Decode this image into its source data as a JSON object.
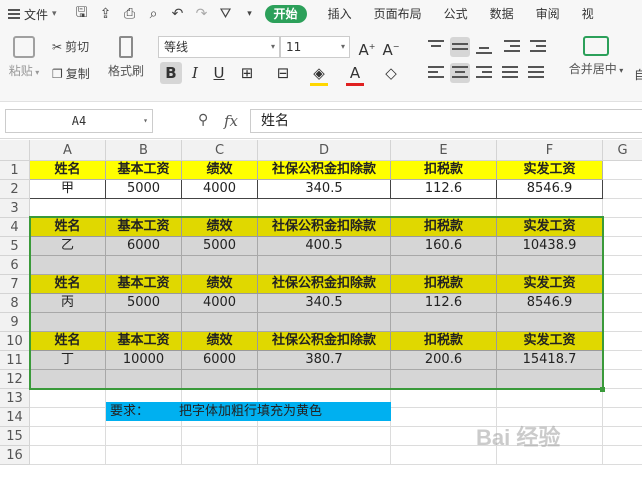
{
  "menu": {
    "file_label": "文件",
    "tabs": [
      "开始",
      "插入",
      "页面布局",
      "公式",
      "数据",
      "审阅",
      "视"
    ],
    "active_tab": "开始"
  },
  "ribbon": {
    "paste": "粘贴",
    "cut": "剪切",
    "copy": "复制",
    "format_painter": "格式刷",
    "font_name": "等线",
    "font_size": "11",
    "merge_center": "合并居中",
    "auto_partial": "自"
  },
  "formula_bar": {
    "cell_ref": "A4",
    "fx": "fx",
    "content": "姓名"
  },
  "grid": {
    "columns": [
      "A",
      "B",
      "C",
      "D",
      "E",
      "F",
      "G"
    ],
    "rows": [
      "1",
      "2",
      "3",
      "4",
      "5",
      "6",
      "7",
      "8",
      "9",
      "10",
      "11",
      "12",
      "13",
      "14",
      "15",
      "16"
    ],
    "header_cells": [
      "姓名",
      "基本工资",
      "绩效",
      "社保公积金扣除款",
      "扣税款",
      "实发工资"
    ],
    "record1": [
      "甲",
      "5000",
      "4000",
      "340.5",
      "112.6",
      "8546.9"
    ],
    "record2": [
      "乙",
      "6000",
      "5000",
      "400.5",
      "160.6",
      "10438.9"
    ],
    "record3": [
      "丙",
      "5000",
      "4000",
      "340.5",
      "112.6",
      "8546.9"
    ],
    "record4": [
      "丁",
      "10000",
      "6000",
      "380.7",
      "200.6",
      "15418.7"
    ],
    "note_prefix": "要求：",
    "note_text": "把字体加粗行填充为黄色"
  },
  "watermark": "Bai 经验",
  "colors": {
    "accent": "#2ca05a",
    "header_yellow": "#ffff00",
    "header_dark_yellow": "#e0d800",
    "row_gray": "#d6d6d6",
    "note_blue": "#00b0f0",
    "selection_green": "#3a9a3a"
  }
}
